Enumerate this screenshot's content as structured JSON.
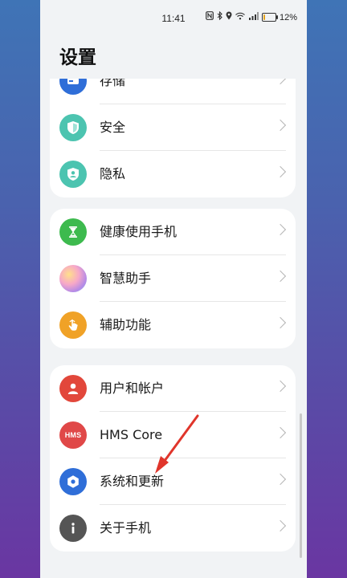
{
  "status_bar": {
    "time": "11:41",
    "battery_percent": "12%",
    "battery_level": 0.12,
    "icons": [
      "nfc-icon",
      "bluetooth-icon",
      "location-icon",
      "wifi-icon",
      "signal-icon",
      "battery-icon"
    ]
  },
  "page": {
    "title": "设置"
  },
  "groups": [
    {
      "items": [
        {
          "label": "存储",
          "icon": "storage-icon",
          "color": "#2f6ed8"
        },
        {
          "label": "安全",
          "icon": "shield-icon",
          "color": "#4cc4b0"
        },
        {
          "label": "隐私",
          "icon": "privacy-shield-icon",
          "color": "#4cc4b0"
        }
      ]
    },
    {
      "items": [
        {
          "label": "健康使用手机",
          "icon": "hourglass-icon",
          "color": "#3dba4e"
        },
        {
          "label": "智慧助手",
          "icon": "assistant-orb-icon",
          "color": "#d98ac4"
        },
        {
          "label": "辅助功能",
          "icon": "hand-pointer-icon",
          "color": "#f0a227"
        }
      ]
    },
    {
      "items": [
        {
          "label": "用户和帐户",
          "icon": "user-icon",
          "color": "#e2473b"
        },
        {
          "label": "HMS Core",
          "icon": "hms-logo-icon",
          "color": "#e04848",
          "icon_text": "HMS"
        },
        {
          "label": "系统和更新",
          "icon": "gear-icon",
          "color": "#2f6ed8"
        },
        {
          "label": "关于手机",
          "icon": "info-icon",
          "color": "#555555"
        }
      ]
    }
  ],
  "annotation": {
    "arrow_color": "#e0352b"
  }
}
